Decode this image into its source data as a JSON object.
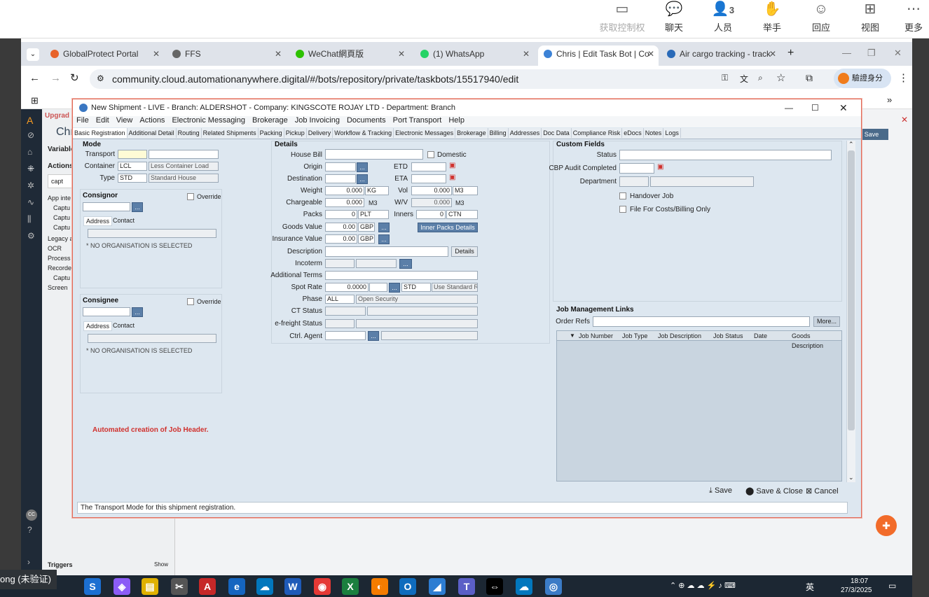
{
  "meeting": {
    "items": [
      {
        "label": "获取控制权",
        "icon": "screen-share-icon"
      },
      {
        "label": "聊天",
        "icon": "chat-icon"
      },
      {
        "label": "人员",
        "icon": "people-icon",
        "count": "3"
      },
      {
        "label": "举手",
        "icon": "hand-icon"
      },
      {
        "label": "回应",
        "icon": "smile-icon"
      },
      {
        "label": "视图",
        "icon": "grid-icon"
      },
      {
        "label": "更多",
        "icon": "more-icon"
      }
    ]
  },
  "browser": {
    "tabs": [
      {
        "title": "GlobalProtect Portal",
        "color": "#e8632a"
      },
      {
        "title": "FFS",
        "color": "#666"
      },
      {
        "title": "WeChat網頁版",
        "color": "#2dc100"
      },
      {
        "title": "(1) WhatsApp",
        "color": "#25d366"
      },
      {
        "title": "Chris | Edit Task Bot | Co",
        "color": "#3c82d6"
      },
      {
        "title": "Air cargo tracking - track",
        "color": "#2a6ab8"
      }
    ],
    "url": "community.cloud.automationanywhere.digital/#/bots/repository/private/taskbots/15517940/edit",
    "profile": "驗證身分"
  },
  "dialog": {
    "title": "New Shipment - LIVE - Branch: ALDERSHOT - Company: KINGSCOTE ROJAY LTD - Department: Branch",
    "menu": [
      "File",
      "Edit",
      "View",
      "Actions",
      "Electronic Messaging",
      "Brokerage",
      "Job Invoicing",
      "Documents",
      "Port Transport",
      "Help"
    ],
    "tabs": [
      "Basic Registration",
      "Additional Detail",
      "Routing",
      "Related Shipments",
      "Packing",
      "Pickup",
      "Delivery",
      "Workflow & Tracking",
      "Electronic Messages",
      "Brokerage",
      "Billing",
      "Addresses",
      "Doc Data",
      "Compliance Risk",
      "eDocs",
      "Notes",
      "Logs"
    ],
    "mode": {
      "heading": "Mode",
      "transport_label": "Transport",
      "container_label": "Container",
      "container_code": "LCL",
      "container_desc": "Less Container Load",
      "type_label": "Type",
      "type_code": "STD",
      "type_desc": "Standard House"
    },
    "consignor": {
      "heading": "Consignor",
      "override": "Override",
      "tab_address": "Address",
      "tab_contact": "Contact",
      "none": "* NO ORGANISATION IS SELECTED"
    },
    "consignee": {
      "heading": "Consignee",
      "override": "Override",
      "tab_address": "Address",
      "tab_contact": "Contact",
      "none": "* NO ORGANISATION IS SELECTED"
    },
    "note": "Automated creation of Job Header.",
    "details": {
      "heading": "Details",
      "house_bill": "House Bill",
      "domestic": "Domestic",
      "origin": "Origin",
      "etd": "ETD",
      "destination": "Destination",
      "eta": "ETA",
      "weight": "Weight",
      "weight_val": "0.000",
      "weight_unit": "KG",
      "vol": "Vol",
      "vol_val": "0.000",
      "vol_unit": "M3",
      "chargeable": "Chargeable",
      "chargeable_val": "0.000",
      "chargeable_unit": "M3",
      "wv": "W/V",
      "wv_val": "0.000",
      "wv_unit": "M3",
      "packs": "Packs",
      "packs_val": "0",
      "packs_unit": "PLT",
      "inners": "Inners",
      "inners_val": "0",
      "inners_unit": "CTN",
      "goods_value": "Goods Value",
      "goods_val": "0.00",
      "goods_cur": "GBP",
      "inner_packs_btn": "Inner Packs Details",
      "insurance_value": "Insurance Value",
      "ins_val": "0.00",
      "ins_cur": "GBP",
      "description": "Description",
      "details_btn": "Details",
      "incoterm": "Incoterm",
      "additional_terms": "Additional Terms",
      "spot_rate": "Spot Rate",
      "spot_val": "0.0000",
      "spot_code": "STD",
      "spot_std": "Use Standard Ra",
      "phase": "Phase",
      "phase_code": "ALL",
      "phase_desc": "Open Security",
      "ct_status": "CT Status",
      "efreight": "e-freight Status",
      "ctrl_agent": "Ctrl. Agent"
    },
    "custom": {
      "heading": "Custom Fields",
      "status": "Status",
      "cbp": "CBP Audit Completed",
      "department": "Department",
      "handover": "Handover Job",
      "costs": "File For Costs/Billing Only"
    },
    "jobs": {
      "heading": "Job Management Links",
      "order_refs": "Order Refs",
      "more": "More...",
      "columns": [
        "Job Number",
        "Job Type",
        "Job Description",
        "Job Status",
        "Date",
        "Goods Description"
      ]
    },
    "buttons": {
      "save": "Save",
      "save_close": "Save & Close",
      "cancel": "Cancel"
    },
    "status": "The Transport Mode for this shipment registration."
  },
  "side": {
    "items": [
      "Variables",
      "Actions",
      "capt",
      "App inte",
      "Captu",
      "Captu",
      "Captu",
      "Legacy a",
      "OCR",
      "Process",
      "Recorde",
      "Captu",
      "Screen"
    ],
    "triggers": "Triggers",
    "show": "Show",
    "save": "Save",
    "upgrade": "Upgrad",
    "chr": "Chri"
  },
  "taskbar": {
    "label": "ong (未验证)",
    "time": "18:07",
    "date": "27/3/2025",
    "lang": "英"
  }
}
